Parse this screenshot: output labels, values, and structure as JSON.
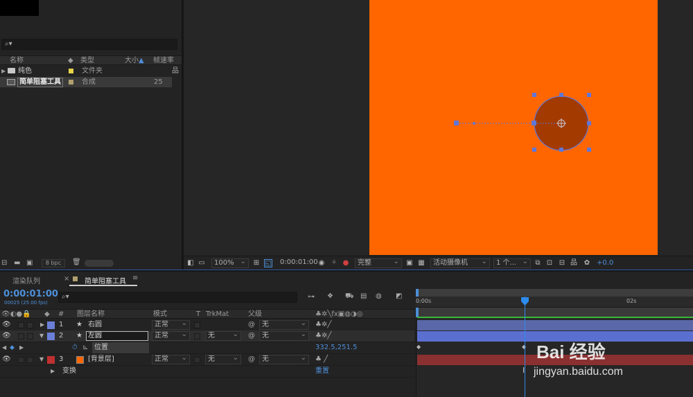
{
  "project": {
    "columns": {
      "name": "名称",
      "type": "类型",
      "size": "大小",
      "framerate": "帧速率"
    },
    "items": [
      {
        "name": "纯色",
        "type": "文件夹",
        "frames": "",
        "color": "#e6d34a"
      },
      {
        "name": "简单阻塞工具",
        "type": "合成",
        "frames": "25",
        "color": "#b0a070"
      }
    ],
    "bpc": "8 bpc"
  },
  "viewer": {
    "zoom": "100%",
    "time": "0:00:01:00",
    "resolution": "完整",
    "camera": "活动摄像机",
    "views": "1 个...",
    "exposure": "+0.0",
    "canvas_color": "#ff6600"
  },
  "timeline": {
    "tabs": [
      "渲染队列",
      "简单阻塞工具"
    ],
    "timecode": "0:00:01:00",
    "frames_info": "00025 (25.00 fps)",
    "header": {
      "num": "#",
      "name": "图层名称",
      "mode": "模式",
      "t": "T",
      "trkmat": "TrkMat",
      "parent": "父级"
    },
    "ruler": {
      "start": "0:00s",
      "mark2": "02s"
    },
    "layers": [
      {
        "num": "1",
        "name": "右圆",
        "mode": "正常",
        "trk": "",
        "parent": "无",
        "color": "#6b7fd8"
      },
      {
        "num": "2",
        "name": "左圆",
        "mode": "正常",
        "trk": "无",
        "parent": "无",
        "color": "#6b7fd8"
      },
      {
        "num": "3",
        "name": "[背景层]",
        "mode": "正常",
        "trk": "无",
        "parent": "无",
        "color": "#c03030"
      }
    ],
    "position_prop": {
      "label": "位置",
      "value": "332.5,251.5"
    },
    "transform": {
      "label": "变换",
      "reset": "重置"
    }
  },
  "watermark": {
    "brand": "Bai 经验",
    "url": "jingyan.baidu.com"
  }
}
